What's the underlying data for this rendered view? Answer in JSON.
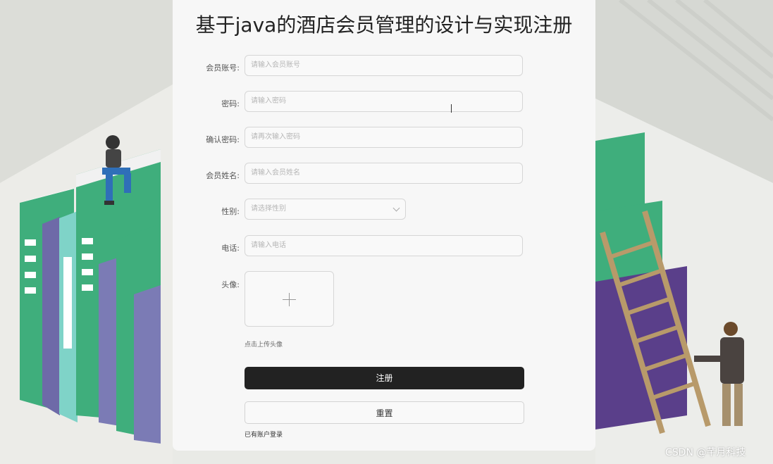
{
  "form": {
    "title": "基于java的酒店会员管理的设计与实现注册",
    "fields": [
      {
        "label": "会员账号:",
        "placeholder": "请输入会员账号"
      },
      {
        "label": "密码:",
        "placeholder": "请输入密码"
      },
      {
        "label": "确认密码:",
        "placeholder": "请再次输入密码"
      },
      {
        "label": "会员姓名:",
        "placeholder": "请输入会员姓名"
      },
      {
        "label": "性别:",
        "placeholder": "请选择性别"
      },
      {
        "label": "电话:",
        "placeholder": "请输入电话"
      }
    ],
    "avatar_label": "头像:",
    "upload_hint": "点击上传头像",
    "register_button": "注册",
    "reset_button": "重置",
    "login_link": "已有账户登录"
  },
  "watermark": "CSDN @芊月科技",
  "icons": {
    "upload": "plus-icon",
    "select": "chevron-down-icon"
  },
  "colors": {
    "primary_button": "#222222",
    "panel": "#f7f7f7"
  }
}
